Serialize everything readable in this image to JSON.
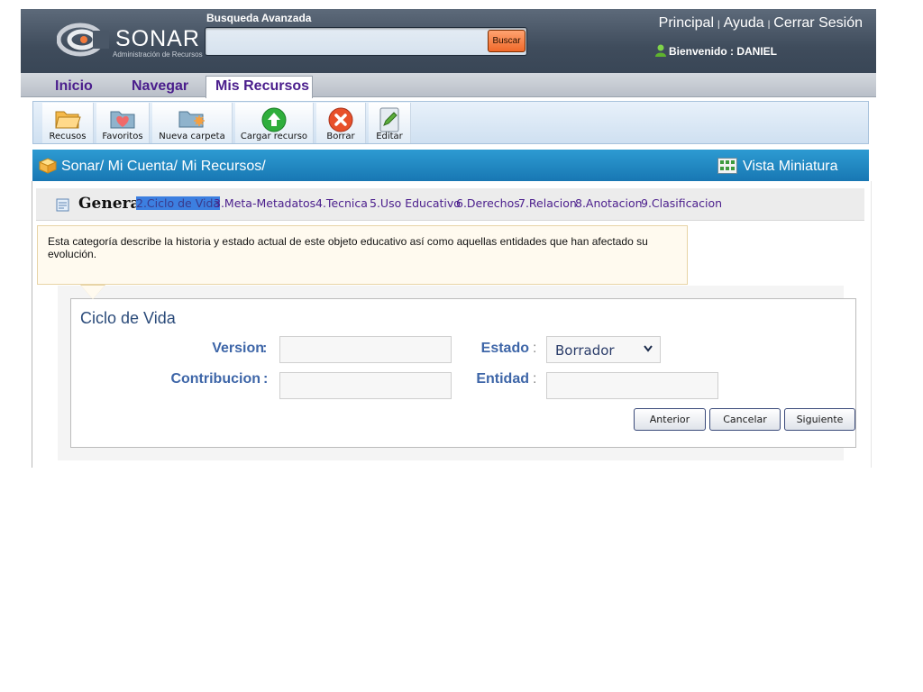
{
  "header": {
    "logo_text": "SONAR",
    "logo_subtitle": "Administración de Recursos",
    "search_label": "Busqueda Avanzada",
    "search_button": "Buscar",
    "search_value": "",
    "links": [
      "Principal",
      "Ayuda",
      "Cerrar Sesión"
    ],
    "link_separator": "|",
    "welcome_prefix": "Bienvenido : ",
    "welcome_user": "DANIEL"
  },
  "nav": {
    "tabs": [
      "Inicio",
      "Navegar",
      "Mis Recursos"
    ],
    "active": "Mis Recursos"
  },
  "toolbar": {
    "items": [
      {
        "label": "Recusos",
        "icon": "folder-open-icon"
      },
      {
        "label": "Favoritos",
        "icon": "favorites-folder-icon"
      },
      {
        "label": "Nueva carpeta",
        "icon": "new-folder-icon"
      },
      {
        "label": "Cargar recurso",
        "icon": "upload-arrow-icon"
      },
      {
        "label": "Borrar",
        "icon": "delete-x-icon"
      },
      {
        "label": "Editar",
        "icon": "edit-pencil-icon"
      }
    ]
  },
  "breadcrumb": {
    "path": "Sonar/ Mi Cuenta/ Mi Recursos/",
    "view_toggle": "Vista Miniatura"
  },
  "steps": {
    "general": "General",
    "items": [
      "2.Ciclo de Vida",
      "3.Meta-Metadatos",
      "4.Tecnica",
      "5.Uso Educativo",
      "6.Derechos",
      "7.Relacion",
      "8.Anotacion",
      "9.Clasificacion"
    ],
    "active": "2.Ciclo de Vida"
  },
  "description": "Esta categoría describe la historia y estado actual de este objeto educativo así como aquellas entidades que han afectado su evolución.",
  "form": {
    "title": "Ciclo de Vida",
    "version_label": "Version",
    "contribucion_label": "Contribucion",
    "estado_label": "Estado",
    "entidad_label": "Entidad",
    "colon": ":",
    "version_value": "",
    "contribucion_value": "",
    "entidad_value": "",
    "estado_selected": "Borrador",
    "buttons": {
      "prev": "Anterior",
      "cancel": "Cancelar",
      "next": "Siguiente"
    }
  },
  "colors": {
    "header_bg": "#4a5767",
    "accent_blue": "#1e85c2",
    "search_button": "#f37a3c",
    "label_blue": "#3e66a8",
    "nav_text": "#4a1d8c"
  }
}
